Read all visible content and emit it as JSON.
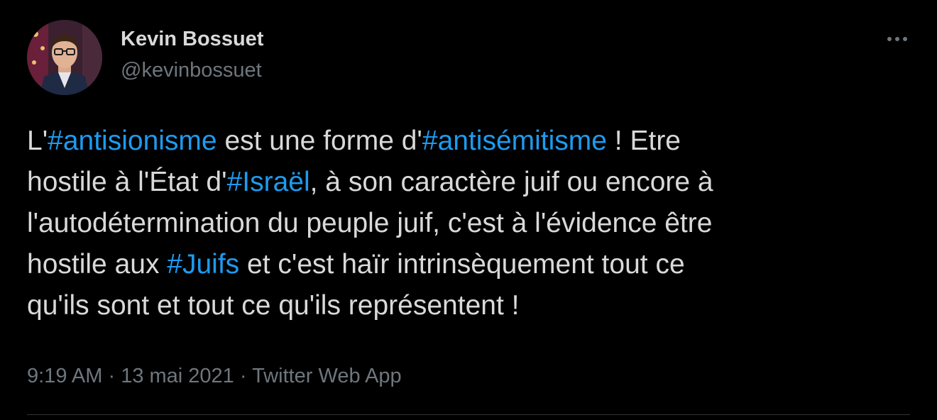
{
  "author": {
    "display_name": "Kevin Bossuet",
    "handle": "@kevinbossuet",
    "avatar_icon": "profile-photo"
  },
  "more_icon": "more-horizontal-icon",
  "tweet": {
    "lines": [
      [
        {
          "text": "L'",
          "hashtag": false
        },
        {
          "text": "#antisionisme",
          "hashtag": true
        },
        {
          "text": " est une forme d'",
          "hashtag": false
        },
        {
          "text": "#antisémitisme",
          "hashtag": true
        },
        {
          "text": " ! Etre",
          "hashtag": false
        }
      ],
      [
        {
          "text": "hostile à l'État d'",
          "hashtag": false
        },
        {
          "text": "#Israël",
          "hashtag": true
        },
        {
          "text": ", à son caractère juif ou encore à",
          "hashtag": false
        }
      ],
      [
        {
          "text": "l'autodétermination du peuple juif, c'est à l'évidence être",
          "hashtag": false
        }
      ],
      [
        {
          "text": "hostile aux ",
          "hashtag": false
        },
        {
          "text": "#Juifs",
          "hashtag": true
        },
        {
          "text": " et c'est haïr intrinsèquement tout ce",
          "hashtag": false
        }
      ],
      [
        {
          "text": "qu'ils sont et tout ce qu'ils représentent !",
          "hashtag": false
        }
      ]
    ]
  },
  "meta": {
    "time": "9:19 AM",
    "separator": " · ",
    "date": "13 mai 2021",
    "source": "Twitter Web App"
  },
  "colors": {
    "background": "#000000",
    "text": "#d9d9d9",
    "secondary": "#6e767d",
    "hashtag": "#1d9bf0"
  }
}
